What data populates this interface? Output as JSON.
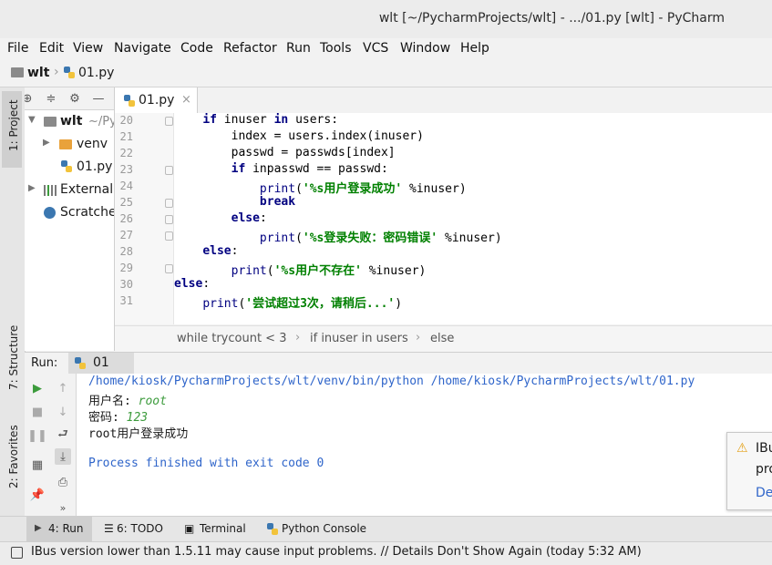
{
  "window": {
    "title": "wlt [~/PycharmProjects/wlt] - .../01.py [wlt] - PyCharm"
  },
  "menu": [
    "File",
    "Edit",
    "View",
    "Navigate",
    "Code",
    "Refactor",
    "Run",
    "Tools",
    "VCS",
    "Window",
    "Help"
  ],
  "nav": {
    "project": "wlt",
    "file": "01.py"
  },
  "left_tabs": {
    "project": "1: Project",
    "structure": "7: Structure",
    "favorites": "2: Favorites"
  },
  "project_tree": {
    "root": "wlt",
    "root_path": "~/Py",
    "venv": "venv",
    "file": "01.py",
    "external": "External",
    "scratches": "Scratche"
  },
  "editor": {
    "tab": "01.py",
    "line_numbers": [
      "20",
      "21",
      "22",
      "23",
      "24",
      "25",
      "26",
      "27",
      "28",
      "29",
      "30",
      "31"
    ],
    "breadcrumb": [
      "while trycount < 3",
      "if inuser in users",
      "else"
    ]
  },
  "run": {
    "label": "Run:",
    "config": "01",
    "console": {
      "cmd": "/home/kiosk/PycharmProjects/wlt/venv/bin/python /home/kiosk/PycharmProjects/wlt/01.py",
      "user_prompt": "用户名:",
      "user_input": "root",
      "pwd_prompt": "密码:",
      "pwd_input": "123",
      "result": "root用户登录成功",
      "exit": "Process finished with exit code 0"
    }
  },
  "bottom_tabs": {
    "run": "4: Run",
    "todo": "6: TODO",
    "terminal": "Terminal",
    "python_console": "Python Console"
  },
  "status": {
    "message": "IBus version lower than 1.5.11 may cause input problems. // Details Don't Show Again (today 5:32 AM)"
  },
  "balloon": {
    "line1": "IBu",
    "line2": "pro",
    "link": "De"
  },
  "colors": {
    "keyword": "#000080",
    "string": "#008000",
    "link": "#2f65ca",
    "run_green": "#3c9b3c"
  }
}
